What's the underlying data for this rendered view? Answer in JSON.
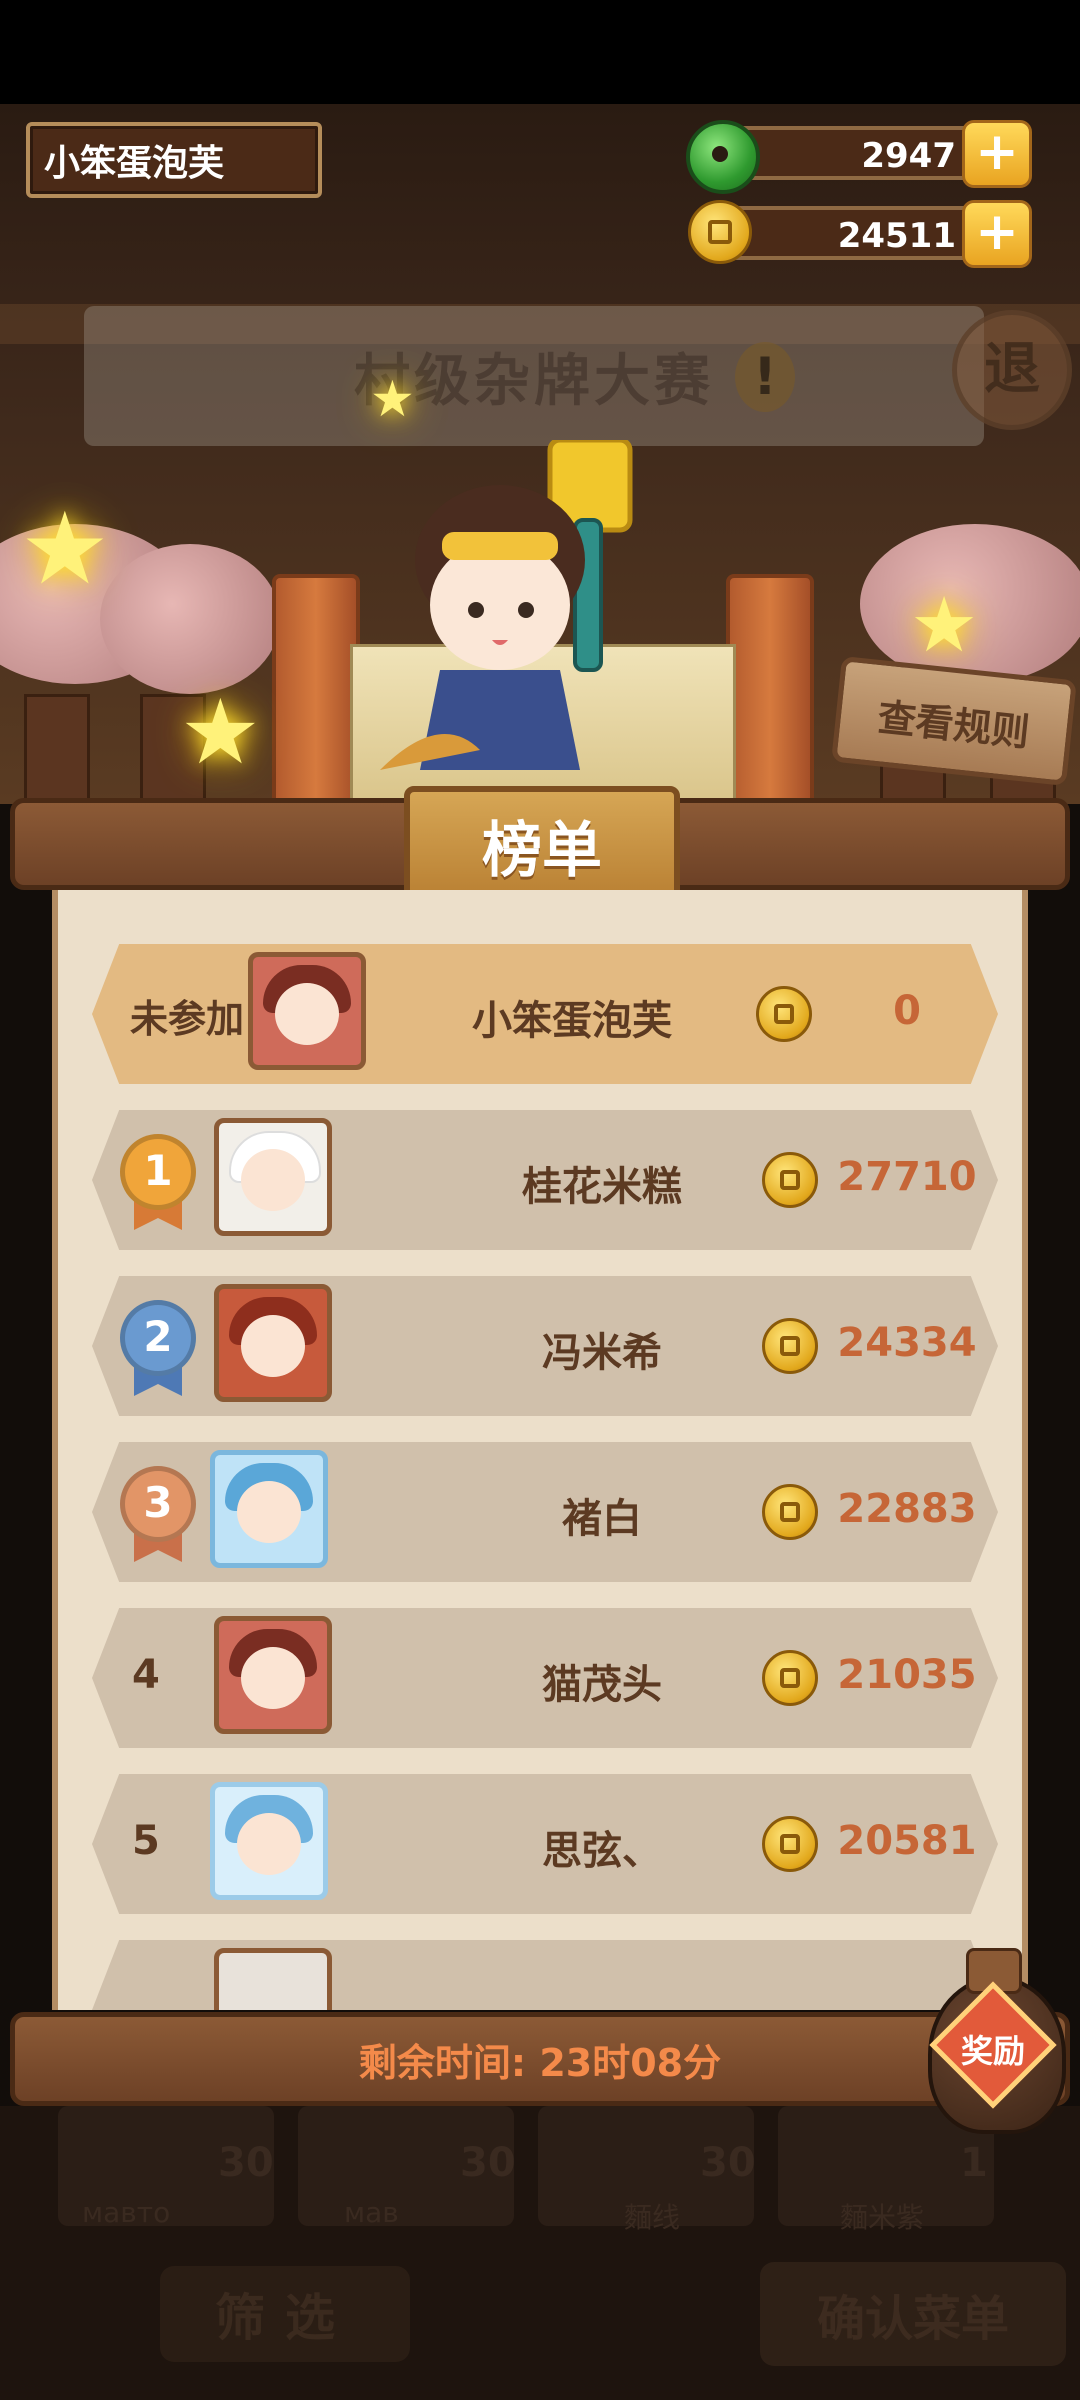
{
  "header": {
    "player_name": "小笨蛋泡芙",
    "jade": "2947",
    "coins": "24511"
  },
  "scene": {
    "match_title": "村级杂牌大赛",
    "exit_label": "退",
    "rules_label": "查看规则"
  },
  "leaderboard": {
    "title": "榜单",
    "self": {
      "status": "未参加",
      "name": "小笨蛋泡芙",
      "score": "0"
    },
    "rows": [
      {
        "rank": "1",
        "name": "桂花米糕",
        "score": "27710",
        "medal": "gold"
      },
      {
        "rank": "2",
        "name": "冯米希",
        "score": "24334",
        "medal": "silver"
      },
      {
        "rank": "3",
        "name": "褚白",
        "score": "22883",
        "medal": "bronze"
      },
      {
        "rank": "4",
        "name": "猫茂头",
        "score": "21035"
      },
      {
        "rank": "5",
        "name": "思弦、",
        "score": "20581"
      }
    ],
    "time_remaining": "剩余时间: 23时08分",
    "reward_label": "奖励"
  },
  "bottom_menu": {
    "dishes": [
      {
        "count": "30",
        "name": "мавто"
      },
      {
        "count": "30",
        "name": "мав"
      },
      {
        "count": "30",
        "name": "麵线"
      },
      {
        "count": "1",
        "name": "麵米紫"
      }
    ],
    "filter_label": "筛选",
    "confirm_label": "确认菜单"
  },
  "colors": {
    "row_self": "#e3ba82",
    "row_normal": "#d0c0ab",
    "gold": "#f0a53a",
    "silver": "#6a9ad0",
    "bronze": "#e29567",
    "score": "#c66637"
  }
}
